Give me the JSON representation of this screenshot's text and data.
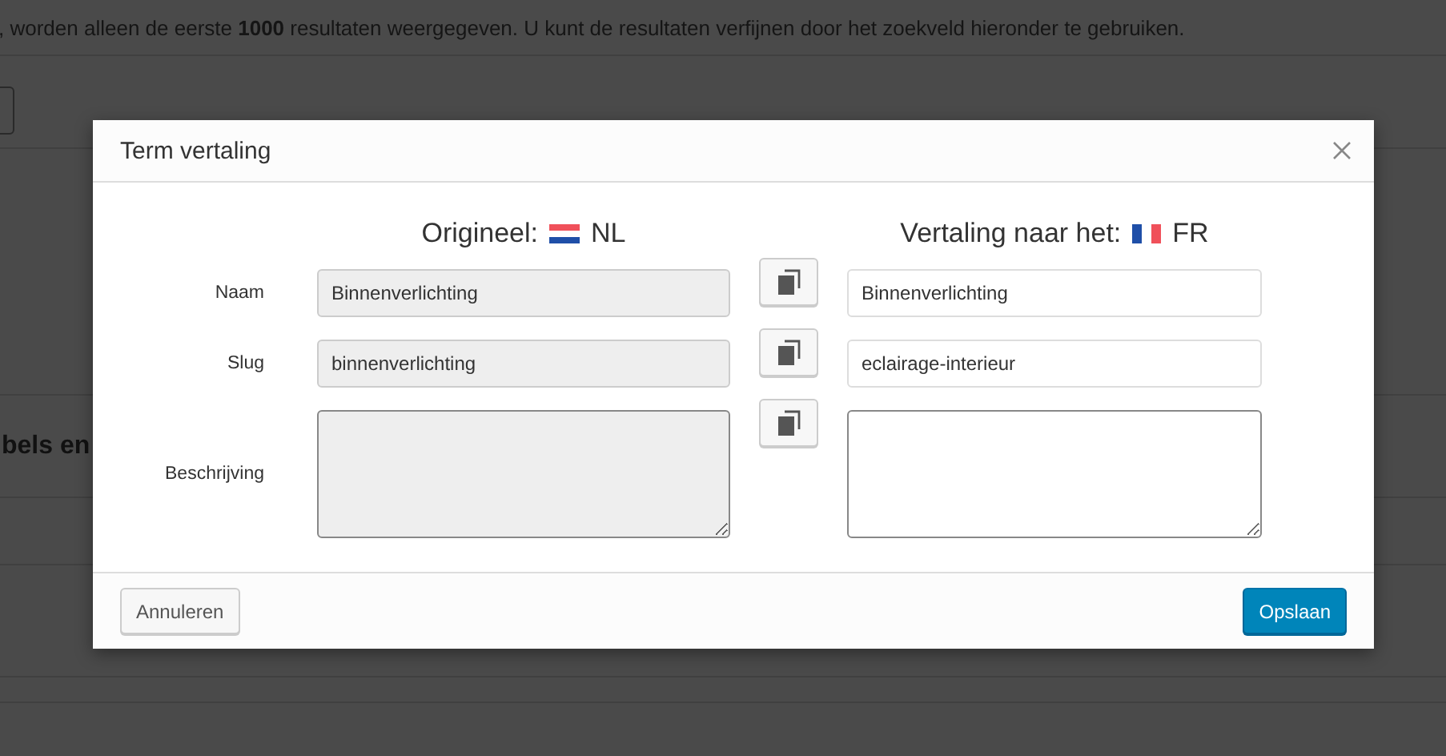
{
  "page": {
    "notice": ", worden alleen de eerste **1000** resultaten weergegeven. U kunt de resultaten verfijnen door het zoekveld hieronder te gebruiken.",
    "section_heading": "bels en"
  },
  "dialog": {
    "title": "Term vertaling",
    "original": {
      "label": "Origineel:",
      "language": "NL"
    },
    "translation": {
      "label": "Vertaling naar het:",
      "language": "FR"
    },
    "rows": [
      {
        "label": "Naam",
        "kind": "input",
        "original": "Binnenverlichting",
        "translation": "Binnenverlichting"
      },
      {
        "label": "Slug",
        "kind": "input",
        "original": "binnenverlichting",
        "translation": "eclairage-interieur"
      },
      {
        "label": "Beschrijving",
        "kind": "textarea"
      }
    ],
    "buttons": {
      "cancel": "Annuleren",
      "save": "Opslaan"
    }
  }
}
